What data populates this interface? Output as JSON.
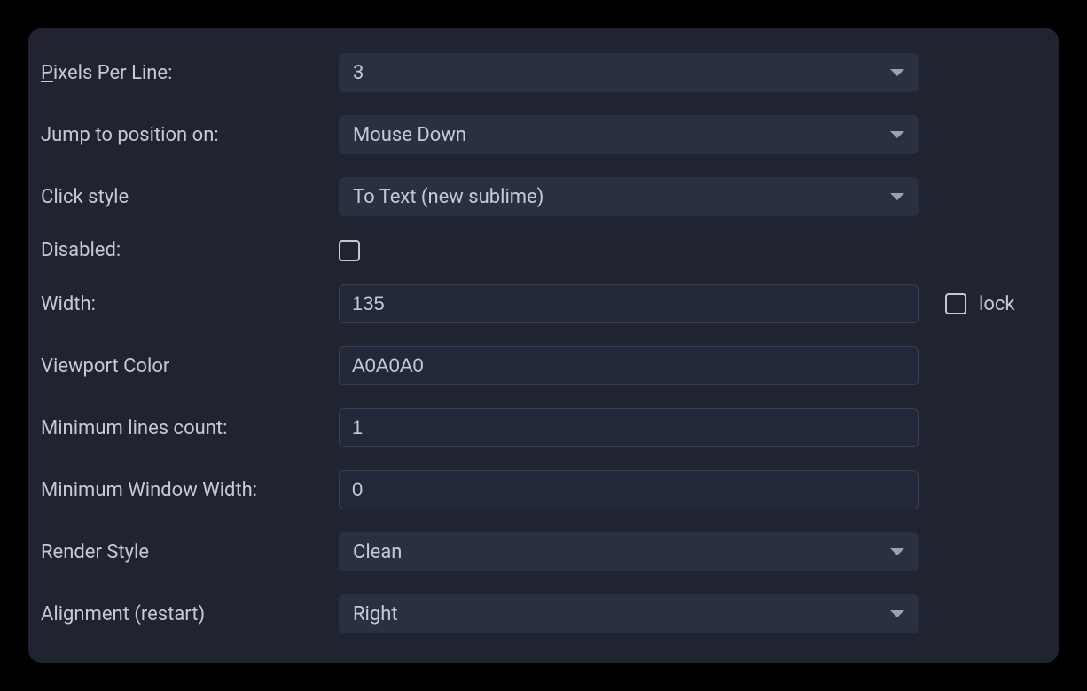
{
  "rows": {
    "pixels_per_line": {
      "label_pre": "P",
      "label_post": "ixels Per Line:",
      "value": "3"
    },
    "jump_to_position": {
      "label": "Jump to position on:",
      "value": "Mouse Down"
    },
    "click_style": {
      "label": "Click style",
      "value": "To Text (new sublime)"
    },
    "disabled": {
      "label": "Disabled:",
      "checked": false
    },
    "width": {
      "label": "Width:",
      "value": "135",
      "lock_label": "lock",
      "lock_checked": false
    },
    "viewport_color": {
      "label": "Viewport Color",
      "value": "A0A0A0"
    },
    "min_lines": {
      "label": "Minimum lines count:",
      "value": "1"
    },
    "min_window_width": {
      "label": "Minimum Window Width:",
      "value": "0"
    },
    "render_style": {
      "label": "Render Style",
      "value": "Clean"
    },
    "alignment": {
      "label": "Alignment (restart)",
      "value": "Right"
    }
  }
}
